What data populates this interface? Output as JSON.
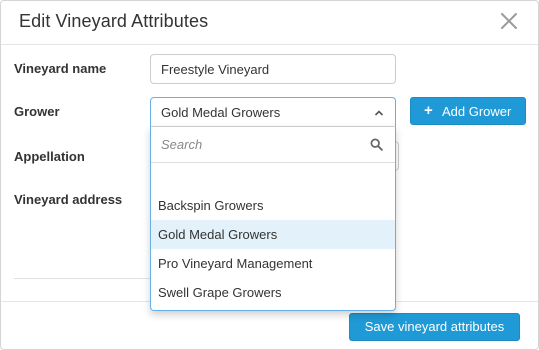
{
  "dialog": {
    "title": "Edit Vineyard Attributes",
    "close_icon": "close-x-icon"
  },
  "form": {
    "vineyard_name": {
      "label": "Vineyard name",
      "value": "Freestyle Vineyard"
    },
    "grower": {
      "label": "Grower",
      "selected": "Gold Medal Growers",
      "add_label": "Add Grower",
      "add_icon": "plus-icon"
    },
    "appellation": {
      "label": "Appellation"
    },
    "vineyard_address": {
      "label": "Vineyard address"
    }
  },
  "dropdown": {
    "search_placeholder": "Search",
    "options": [
      {
        "label": "Backspin Growers",
        "selected": false
      },
      {
        "label": "Gold Medal Growers",
        "selected": true
      },
      {
        "label": "Pro Vineyard Management",
        "selected": false
      },
      {
        "label": "Swell Grape Growers",
        "selected": false
      }
    ]
  },
  "footer": {
    "save_label": "Save vineyard attributes"
  },
  "colors": {
    "primary": "#1f9ad6",
    "focus_border": "#66afe9",
    "selected_option_bg": "#e3f2fa"
  }
}
